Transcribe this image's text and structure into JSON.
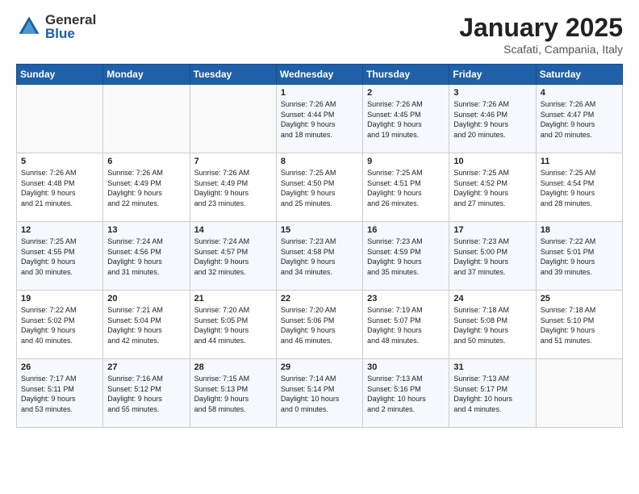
{
  "header": {
    "logo_general": "General",
    "logo_blue": "Blue",
    "title": "January 2025",
    "location": "Scafati, Campania, Italy"
  },
  "weekdays": [
    "Sunday",
    "Monday",
    "Tuesday",
    "Wednesday",
    "Thursday",
    "Friday",
    "Saturday"
  ],
  "weeks": [
    [
      {
        "day": "",
        "info": ""
      },
      {
        "day": "",
        "info": ""
      },
      {
        "day": "",
        "info": ""
      },
      {
        "day": "1",
        "info": "Sunrise: 7:26 AM\nSunset: 4:44 PM\nDaylight: 9 hours\nand 18 minutes."
      },
      {
        "day": "2",
        "info": "Sunrise: 7:26 AM\nSunset: 4:45 PM\nDaylight: 9 hours\nand 19 minutes."
      },
      {
        "day": "3",
        "info": "Sunrise: 7:26 AM\nSunset: 4:46 PM\nDaylight: 9 hours\nand 20 minutes."
      },
      {
        "day": "4",
        "info": "Sunrise: 7:26 AM\nSunset: 4:47 PM\nDaylight: 9 hours\nand 20 minutes."
      }
    ],
    [
      {
        "day": "5",
        "info": "Sunrise: 7:26 AM\nSunset: 4:48 PM\nDaylight: 9 hours\nand 21 minutes."
      },
      {
        "day": "6",
        "info": "Sunrise: 7:26 AM\nSunset: 4:49 PM\nDaylight: 9 hours\nand 22 minutes."
      },
      {
        "day": "7",
        "info": "Sunrise: 7:26 AM\nSunset: 4:49 PM\nDaylight: 9 hours\nand 23 minutes."
      },
      {
        "day": "8",
        "info": "Sunrise: 7:25 AM\nSunset: 4:50 PM\nDaylight: 9 hours\nand 25 minutes."
      },
      {
        "day": "9",
        "info": "Sunrise: 7:25 AM\nSunset: 4:51 PM\nDaylight: 9 hours\nand 26 minutes."
      },
      {
        "day": "10",
        "info": "Sunrise: 7:25 AM\nSunset: 4:52 PM\nDaylight: 9 hours\nand 27 minutes."
      },
      {
        "day": "11",
        "info": "Sunrise: 7:25 AM\nSunset: 4:54 PM\nDaylight: 9 hours\nand 28 minutes."
      }
    ],
    [
      {
        "day": "12",
        "info": "Sunrise: 7:25 AM\nSunset: 4:55 PM\nDaylight: 9 hours\nand 30 minutes."
      },
      {
        "day": "13",
        "info": "Sunrise: 7:24 AM\nSunset: 4:56 PM\nDaylight: 9 hours\nand 31 minutes."
      },
      {
        "day": "14",
        "info": "Sunrise: 7:24 AM\nSunset: 4:57 PM\nDaylight: 9 hours\nand 32 minutes."
      },
      {
        "day": "15",
        "info": "Sunrise: 7:23 AM\nSunset: 4:58 PM\nDaylight: 9 hours\nand 34 minutes."
      },
      {
        "day": "16",
        "info": "Sunrise: 7:23 AM\nSunset: 4:59 PM\nDaylight: 9 hours\nand 35 minutes."
      },
      {
        "day": "17",
        "info": "Sunrise: 7:23 AM\nSunset: 5:00 PM\nDaylight: 9 hours\nand 37 minutes."
      },
      {
        "day": "18",
        "info": "Sunrise: 7:22 AM\nSunset: 5:01 PM\nDaylight: 9 hours\nand 39 minutes."
      }
    ],
    [
      {
        "day": "19",
        "info": "Sunrise: 7:22 AM\nSunset: 5:02 PM\nDaylight: 9 hours\nand 40 minutes."
      },
      {
        "day": "20",
        "info": "Sunrise: 7:21 AM\nSunset: 5:04 PM\nDaylight: 9 hours\nand 42 minutes."
      },
      {
        "day": "21",
        "info": "Sunrise: 7:20 AM\nSunset: 5:05 PM\nDaylight: 9 hours\nand 44 minutes."
      },
      {
        "day": "22",
        "info": "Sunrise: 7:20 AM\nSunset: 5:06 PM\nDaylight: 9 hours\nand 46 minutes."
      },
      {
        "day": "23",
        "info": "Sunrise: 7:19 AM\nSunset: 5:07 PM\nDaylight: 9 hours\nand 48 minutes."
      },
      {
        "day": "24",
        "info": "Sunrise: 7:18 AM\nSunset: 5:08 PM\nDaylight: 9 hours\nand 50 minutes."
      },
      {
        "day": "25",
        "info": "Sunrise: 7:18 AM\nSunset: 5:10 PM\nDaylight: 9 hours\nand 51 minutes."
      }
    ],
    [
      {
        "day": "26",
        "info": "Sunrise: 7:17 AM\nSunset: 5:11 PM\nDaylight: 9 hours\nand 53 minutes."
      },
      {
        "day": "27",
        "info": "Sunrise: 7:16 AM\nSunset: 5:12 PM\nDaylight: 9 hours\nand 55 minutes."
      },
      {
        "day": "28",
        "info": "Sunrise: 7:15 AM\nSunset: 5:13 PM\nDaylight: 9 hours\nand 58 minutes."
      },
      {
        "day": "29",
        "info": "Sunrise: 7:14 AM\nSunset: 5:14 PM\nDaylight: 10 hours\nand 0 minutes."
      },
      {
        "day": "30",
        "info": "Sunrise: 7:13 AM\nSunset: 5:16 PM\nDaylight: 10 hours\nand 2 minutes."
      },
      {
        "day": "31",
        "info": "Sunrise: 7:13 AM\nSunset: 5:17 PM\nDaylight: 10 hours\nand 4 minutes."
      },
      {
        "day": "",
        "info": ""
      }
    ]
  ]
}
